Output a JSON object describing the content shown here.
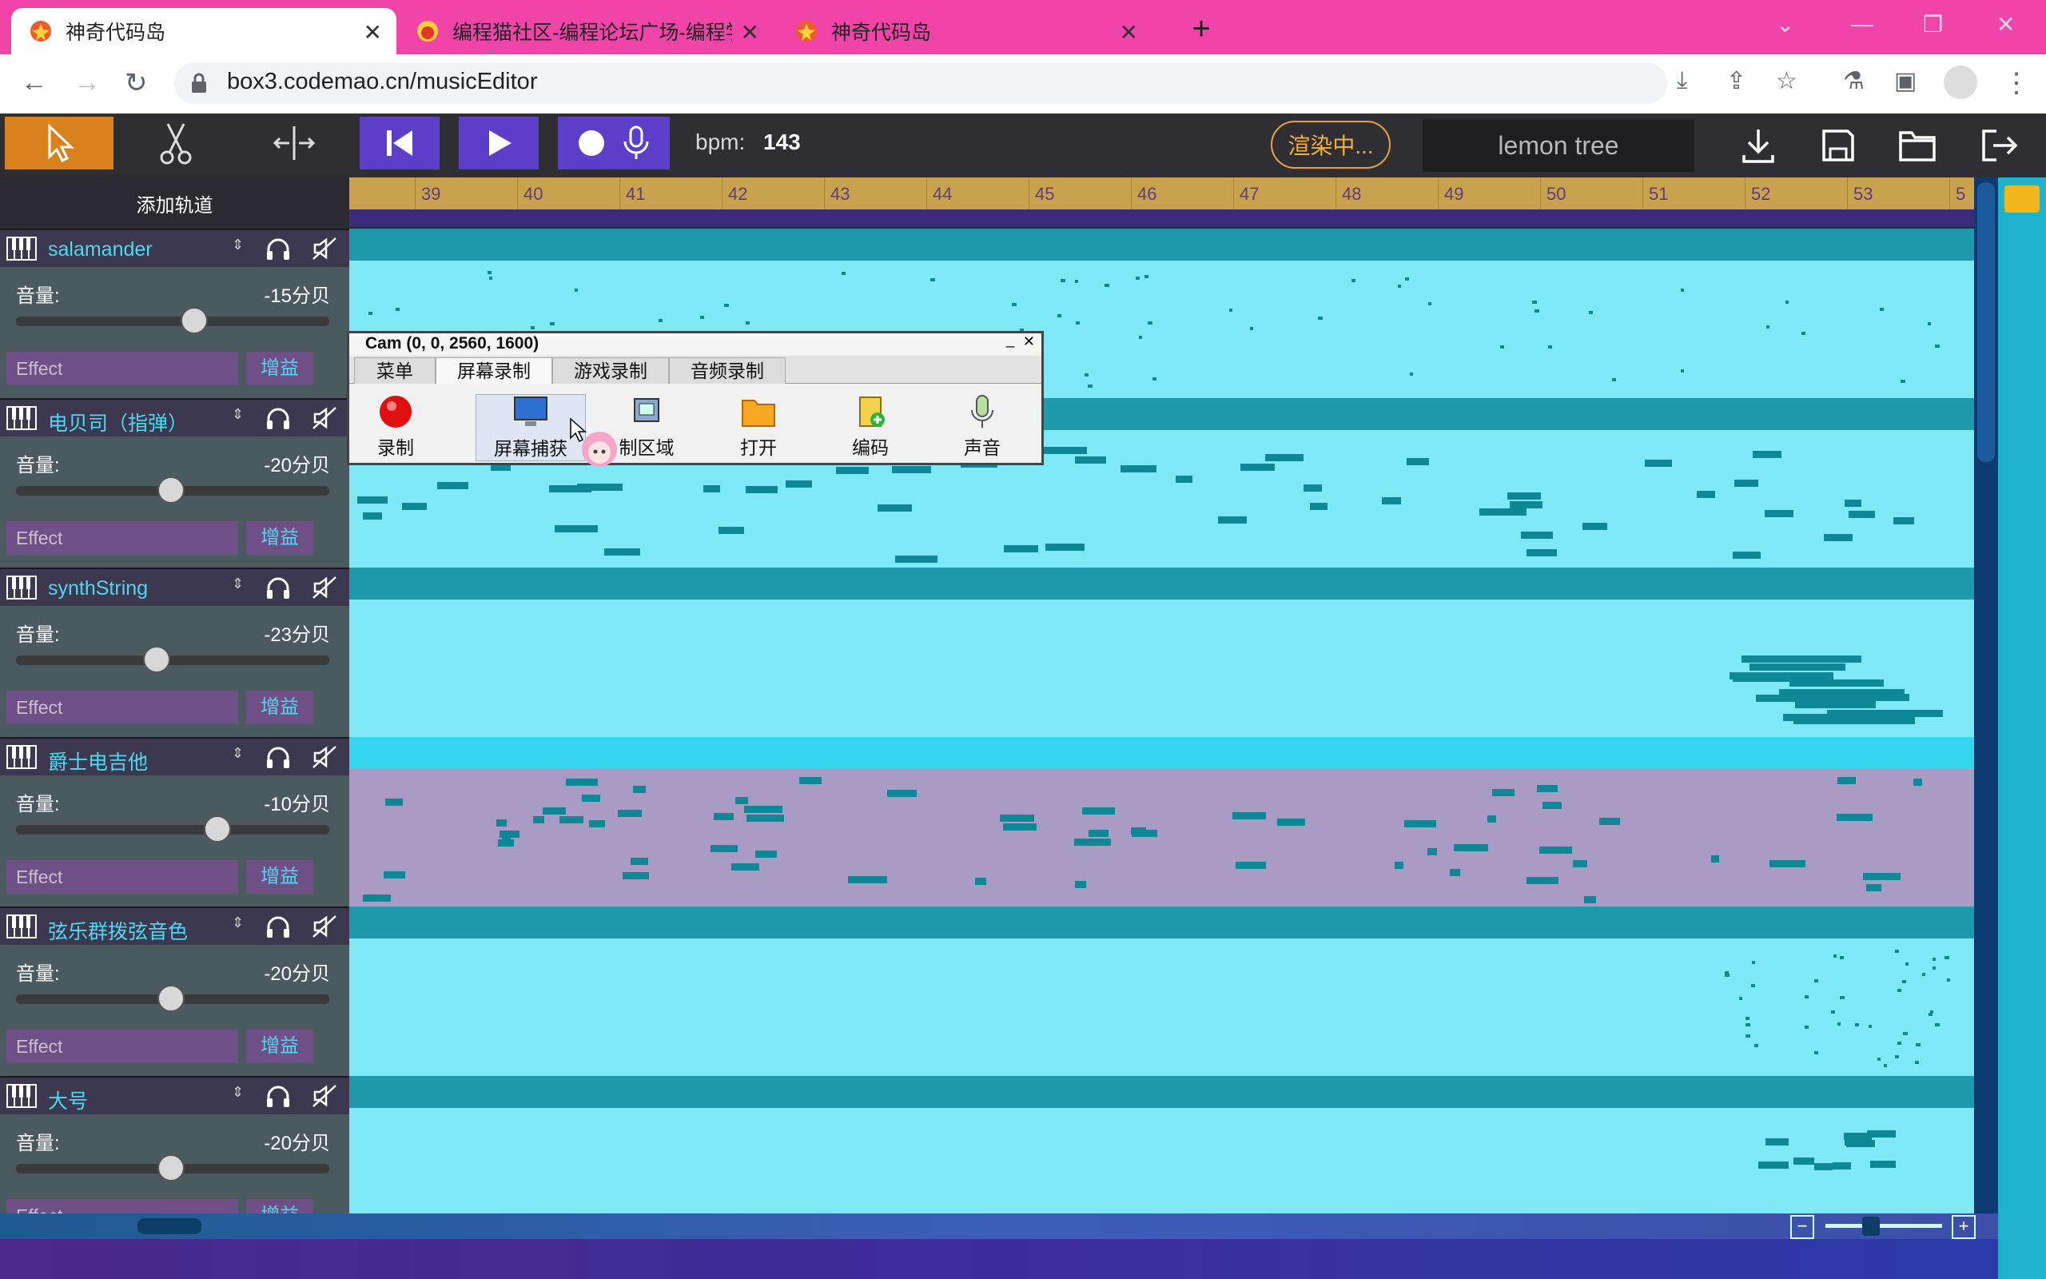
{
  "browser": {
    "tabs": [
      {
        "title": "神奇代码岛",
        "active": true
      },
      {
        "title": "编程猫社区-编程论坛广场-编程学",
        "active": false
      },
      {
        "title": "神奇代码岛",
        "active": false
      }
    ],
    "new_tab": "+",
    "url": "box3.codemao.cn/musicEditor",
    "tab_bar_color": "#f044a8"
  },
  "app": {
    "bpm_label": "bpm:",
    "bpm_value": "143",
    "render_status": "渲染中...",
    "song_name": "lemon tree",
    "add_track": "添加轨道",
    "toolbar_icons": [
      "select-icon",
      "scissors-icon",
      "split-icon",
      "skip-back-icon",
      "play-icon",
      "record-icon",
      "microphone-icon",
      "download-icon",
      "save-icon",
      "folder-icon",
      "logout-icon"
    ]
  },
  "ruler": {
    "bars": [
      "39",
      "40",
      "41",
      "42",
      "43",
      "44",
      "45",
      "46",
      "47",
      "48",
      "49",
      "50",
      "51",
      "52",
      "53",
      "5"
    ]
  },
  "tracks": [
    {
      "name": "salamander",
      "volume_label": "音量:",
      "db": "-15分贝",
      "level": 0.57,
      "effect": "Effect",
      "gain": "增益"
    },
    {
      "name": "电贝司（指弹）",
      "volume_label": "音量:",
      "db": "-20分贝",
      "level": 0.49,
      "effect": "Effect",
      "gain": "增益"
    },
    {
      "name": "synthString",
      "volume_label": "音量:",
      "db": "-23分贝",
      "level": 0.44,
      "effect": "Effect",
      "gain": "增益"
    },
    {
      "name": "爵士电吉他",
      "volume_label": "音量:",
      "db": "-10分贝",
      "level": 0.65,
      "effect": "Effect",
      "gain": "增益"
    },
    {
      "name": "弦乐群拨弦音色",
      "volume_label": "音量:",
      "db": "-20分贝",
      "level": 0.49,
      "effect": "Effect",
      "gain": "增益"
    },
    {
      "name": "大号",
      "volume_label": "音量:",
      "db": "-20分贝",
      "level": 0.49,
      "effect": "Effect",
      "gain": "增益"
    }
  ],
  "bandicam": {
    "title": "Cam (0, 0, 2560, 1600)",
    "tabs": [
      "菜单",
      "屏幕录制",
      "游戏录制",
      "音频录制"
    ],
    "buttons": [
      "录制",
      "屏幕捕获",
      "制区域",
      "打开",
      "编码",
      "声音"
    ]
  },
  "colors": {
    "accent_orange": "#d9811c",
    "purple_button": "#5b3fc8",
    "lane_bg": "#7ee9f5",
    "note": "#0e8796"
  }
}
